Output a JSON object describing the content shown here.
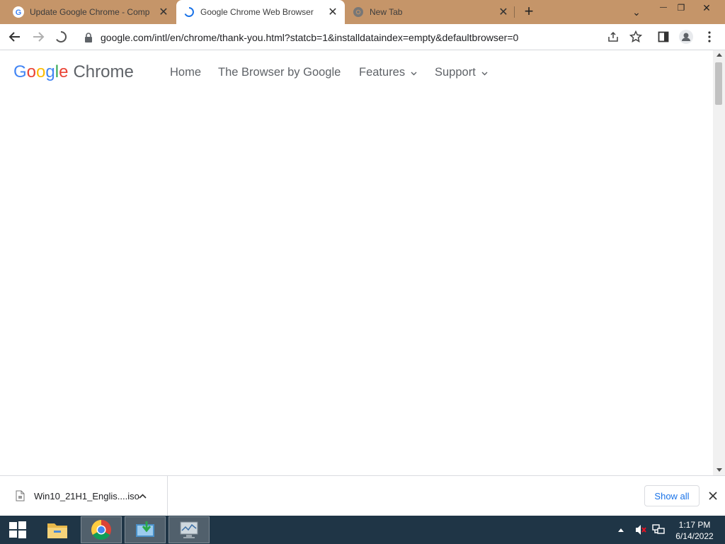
{
  "tabs": [
    {
      "title": "Update Google Chrome - Comp",
      "close": "✕"
    },
    {
      "title": "Google Chrome Web Browser",
      "close": "✕"
    },
    {
      "title": "New Tab",
      "close": "✕"
    }
  ],
  "new_tab_label": "+",
  "window_controls": {
    "minimize": "—",
    "restore": "❐",
    "close": "✕",
    "tab_search": "⌄"
  },
  "address_bar": {
    "url": "google.com/intl/en/chrome/thank-you.html?statcb=1&installdataindex=empty&defaultbrowser=0"
  },
  "site_header": {
    "logo_google": [
      {
        "letter": "G",
        "color": "#4285f4"
      },
      {
        "letter": "o",
        "color": "#ea4335"
      },
      {
        "letter": "o",
        "color": "#fbbc05"
      },
      {
        "letter": "g",
        "color": "#4285f4"
      },
      {
        "letter": "l",
        "color": "#34a853"
      },
      {
        "letter": "e",
        "color": "#ea4335"
      }
    ],
    "logo_product": "Chrome",
    "nav": [
      {
        "label": "Home"
      },
      {
        "label": "The Browser by Google"
      },
      {
        "label": "Features",
        "dropdown": true
      },
      {
        "label": "Support",
        "dropdown": true
      }
    ]
  },
  "download_bar": {
    "filename": "Win10_21H1_Englis....iso",
    "show_all": "Show all"
  },
  "taskbar": {
    "time": "1:17 PM",
    "date": "6/14/2022"
  }
}
